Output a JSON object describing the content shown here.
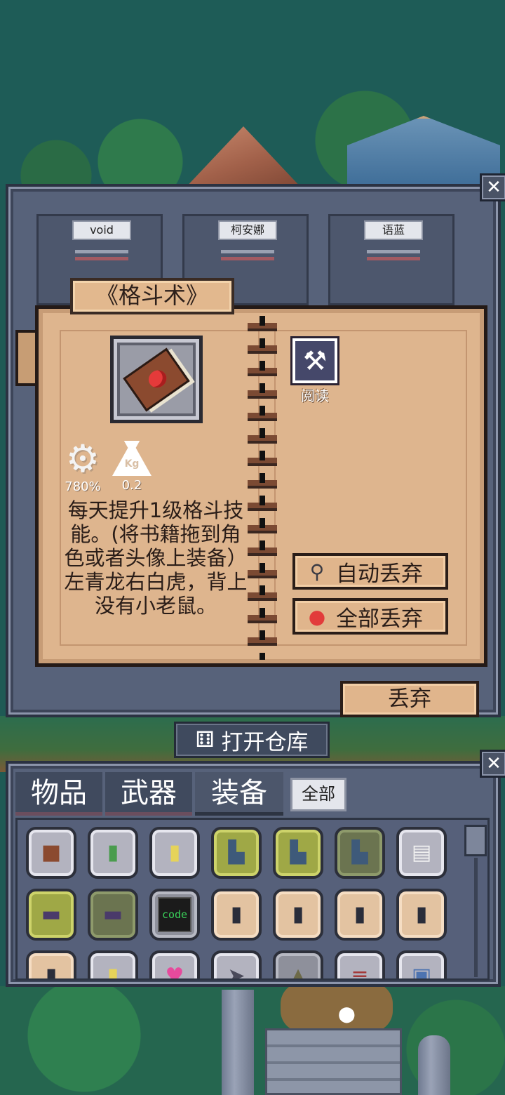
{
  "characters": [
    {
      "name": "void"
    },
    {
      "name": "柯安娜"
    },
    {
      "name": "语蓝"
    }
  ],
  "book": {
    "title": "《格斗术》",
    "stats": {
      "durability": "780%",
      "weight": "0.2",
      "weight_unit": "Kg"
    },
    "description": "每天提升1级格斗技能。(将书籍拖到角色或者头像上装备）左青龙右白虎，背上没有小老鼠。",
    "read_label": "阅读",
    "auto_discard_label": "自动丢弃",
    "discard_all_label": "全部丢弃",
    "discard_label": "丢弃"
  },
  "open_warehouse_label": "打开仓库",
  "inventory": {
    "tabs": [
      {
        "label": "物品"
      },
      {
        "label": "武器"
      },
      {
        "label": "装备"
      }
    ],
    "filter_label": "全部",
    "code_item_label": "code",
    "items": [
      {
        "icon": "book-icon",
        "color": "#8b4a2f"
      },
      {
        "icon": "green-book-icon",
        "color": "#4a9c4e"
      },
      {
        "icon": "yellow-book-icon",
        "color": "#e6d35a"
      },
      {
        "icon": "pants-icon",
        "color": "#3e5a7a"
      },
      {
        "icon": "pants-icon",
        "color": "#3e5a7a"
      },
      {
        "icon": "pants-icon",
        "color": "#3e5a7a"
      },
      {
        "icon": "paper-icon",
        "color": "#f0f0f0"
      },
      {
        "icon": "shoes-icon",
        "color": "#4a3a6a"
      },
      {
        "icon": "shoes-icon",
        "color": "#4a3a6a"
      },
      {
        "icon": "code-book-icon",
        "color": "#1b1b1b"
      },
      {
        "icon": "dark-pants-icon",
        "color": "#2a2d3a"
      },
      {
        "icon": "dark-pants-icon",
        "color": "#2a2d3a"
      },
      {
        "icon": "dark-pants-icon",
        "color": "#2a2d3a"
      },
      {
        "icon": "dark-pants-icon",
        "color": "#2a2d3a"
      },
      {
        "icon": "dark-pants-icon",
        "color": "#2a2d3a"
      },
      {
        "icon": "spatula-book-icon",
        "color": "#e6d35a"
      },
      {
        "icon": "heart-book-icon",
        "color": "#2a6a3a"
      },
      {
        "icon": "cursor-book-icon",
        "color": "#c7c9d6"
      },
      {
        "icon": "jacket-icon",
        "color": "#6d6a48"
      },
      {
        "icon": "book-stack-icon",
        "color": "#a33a3a"
      },
      {
        "icon": "blue-book-icon",
        "color": "#4d73b0"
      }
    ]
  }
}
